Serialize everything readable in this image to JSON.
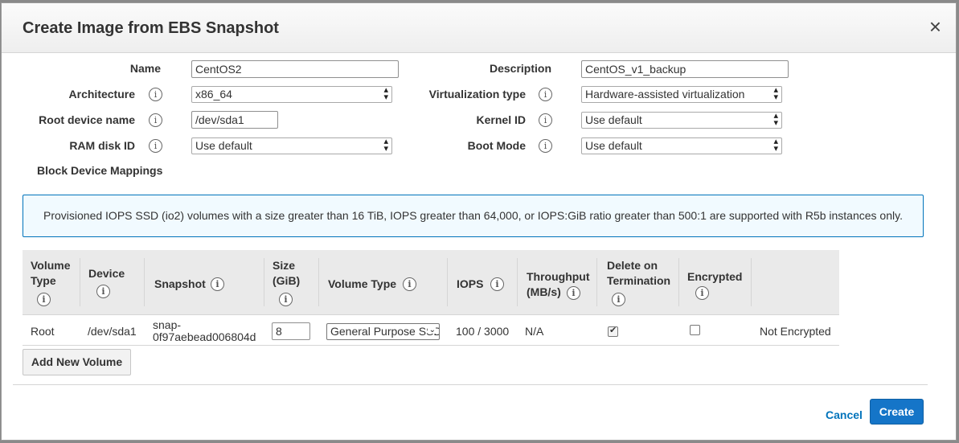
{
  "dialog": {
    "title": "Create Image from EBS Snapshot",
    "close_glyph": "×"
  },
  "form": {
    "name_label": "Name",
    "name_value": "CentOS2",
    "description_label": "Description",
    "description_value": "CentOS_v1_backup",
    "architecture_label": "Architecture",
    "architecture_value": "x86_64",
    "virtualization_label": "Virtualization type",
    "virtualization_value": "Hardware-assisted virtualization",
    "root_device_label": "Root device name",
    "root_device_value": "/dev/sda1",
    "kernel_label": "Kernel ID",
    "kernel_value": "Use default",
    "ramdisk_label": "RAM disk ID",
    "ramdisk_value": "Use default",
    "bootmode_label": "Boot Mode",
    "bootmode_value": "Use default",
    "block_device_label": "Block Device Mappings"
  },
  "notice": {
    "text": "Provisioned IOPS SSD (io2) volumes with a size greater than 16 TiB, IOPS greater than 64,000, or IOPS:GiB ratio greater than 500:1 are supported with R5b instances only."
  },
  "table": {
    "headers": {
      "volume_type_1": "Volume",
      "volume_type_2": "Type",
      "device": "Device",
      "snapshot": "Snapshot",
      "size_1": "Size",
      "size_2": "(GiB)",
      "vol_type": "Volume Type",
      "iops": "IOPS",
      "throughput_1": "Throughput",
      "throughput_2": "(MB/s)",
      "delete_1": "Delete on",
      "delete_2": "Termination",
      "encrypted": "Encrypted"
    },
    "row": {
      "volume_type": "Root",
      "device": "/dev/sda1",
      "snapshot_1": "snap-",
      "snapshot_2": "0f97aebead006804d",
      "size": "8",
      "vol_type": "General Purpose SSD",
      "iops": "100 / 3000",
      "throughput": "N/A",
      "delete_on_termination": true,
      "encrypted": false,
      "encryption_status": "Not Encrypted"
    }
  },
  "buttons": {
    "add_volume": "Add New Volume",
    "cancel": "Cancel",
    "create": "Create"
  },
  "icons": {
    "info": "i",
    "select_arrow": "▴▾",
    "checkmark": "✔"
  },
  "colors": {
    "primary": "#1575c8",
    "link": "#0073bb",
    "notice_bg": "#f1faff",
    "notice_border": "#0073bb"
  }
}
